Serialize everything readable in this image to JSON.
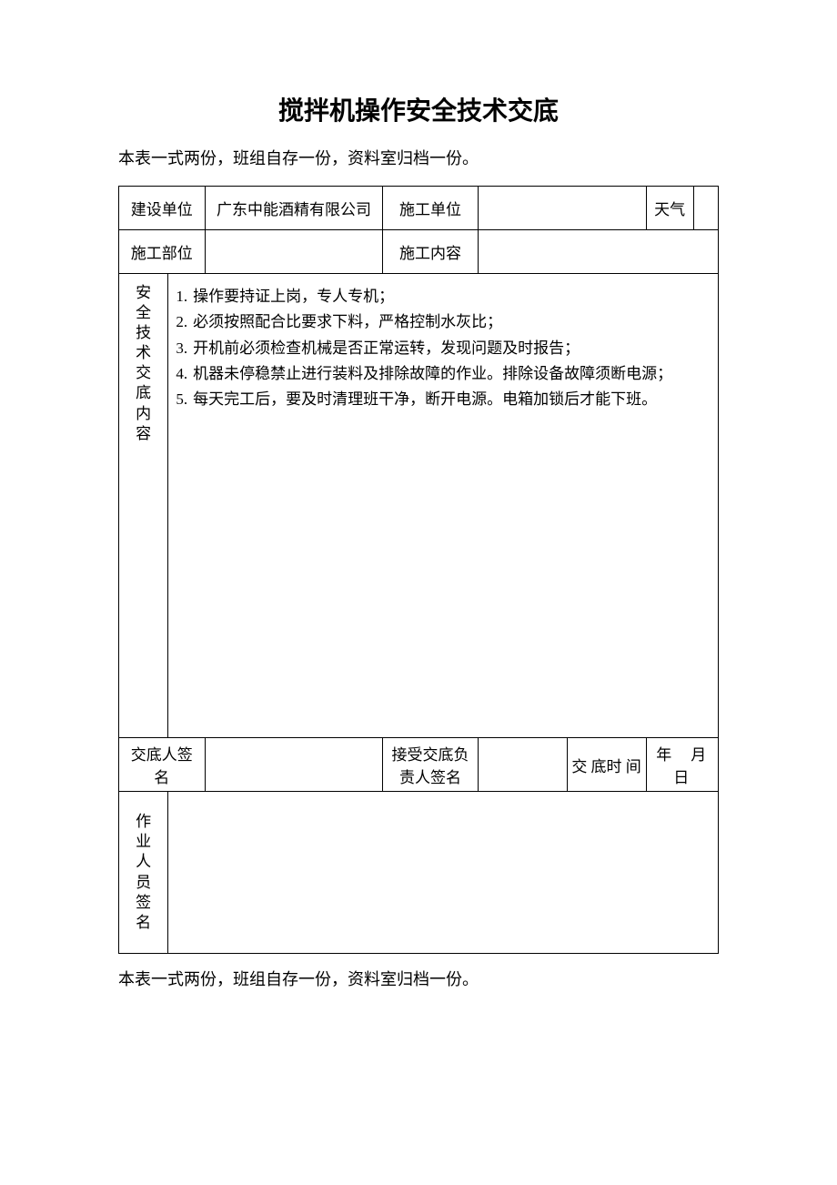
{
  "title": "搅拌机操作安全技术交底",
  "note_top": "本表一式两份，班组自存一份，资料室归档一份。",
  "note_bottom": "本表一式两份，班组自存一份，资料室归档一份。",
  "header": {
    "build_unit_label": "建设单位",
    "build_unit_value": "广东中能酒精有限公司",
    "construction_unit_label": "施工单位",
    "construction_unit_value": "",
    "weather_label": "天气",
    "weather_value": "",
    "construction_part_label": "施工部位",
    "construction_part_value": "",
    "construction_content_label": "施工内容",
    "construction_content_value": ""
  },
  "content": {
    "label": "安全技术交底内容",
    "items": [
      "操作要持证上岗，专人专机；",
      "必须按照配合比要求下料，严格控制水灰比；",
      "开机前必须检查机械是否正常运转，发现问题及时报告；",
      "机器未停稳禁止进行装料及排除故障的作业。排除设备故障须断电源；",
      "每天完工后，要及时清理班干净，断开电源。电箱加锁后才能下班。"
    ]
  },
  "signatures": {
    "disclose_person_label": "交底人签　名",
    "disclose_person_value": "",
    "accept_person_label": "接受交底负责人签名",
    "accept_person_value": "",
    "disclose_time_label": "交 底时 间",
    "disclose_time_value": "年　月　日",
    "worker_sign_label": "作业人员签名",
    "worker_sign_value": ""
  }
}
